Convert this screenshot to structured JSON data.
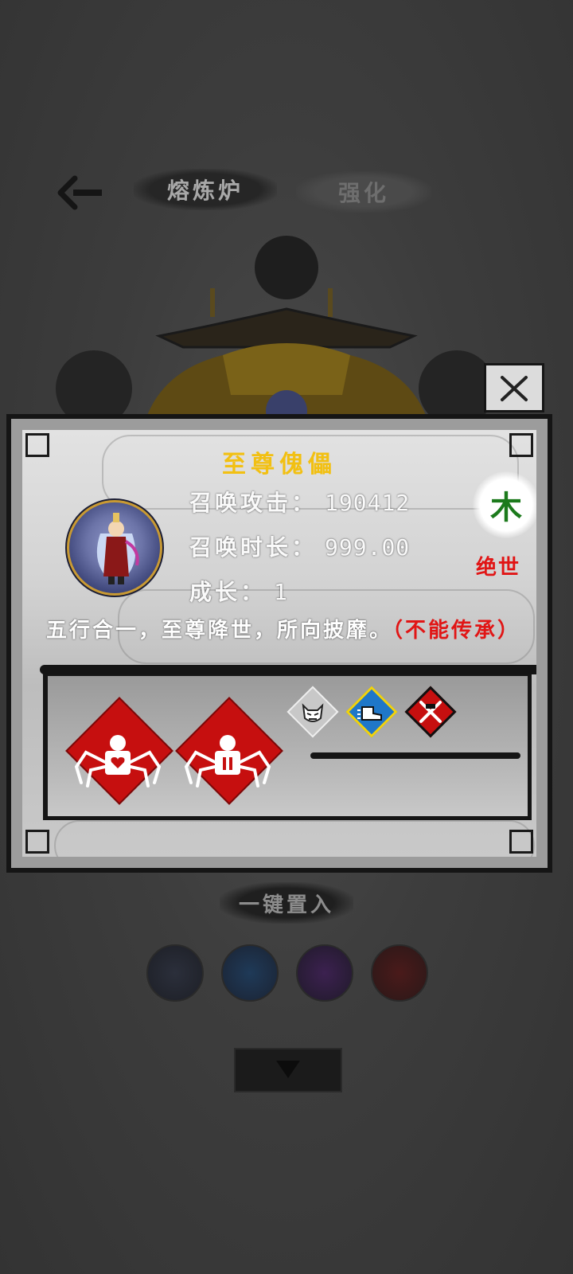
{
  "header": {
    "tabs": [
      {
        "label": "熔炼炉"
      },
      {
        "label": "强化"
      }
    ]
  },
  "furnace": {
    "one_click_label": "一键置入"
  },
  "dialog": {
    "title": "至尊傀儡",
    "stats": [
      {
        "label": "召唤攻击：",
        "value": "190412"
      },
      {
        "label": "召唤时长：",
        "value": "999.00"
      },
      {
        "label": "成长：",
        "value": "1"
      }
    ],
    "element": "木",
    "rank": "绝世",
    "description": "五行合一，至尊降世，所向披靡。",
    "description_note": "（不能传承）"
  },
  "colors": {
    "title": "#f2c012",
    "rank": "#e11515",
    "element": "#1c7a1c",
    "skill_bg": "#c60f0f"
  },
  "icons": {
    "back": "back-arrow-icon",
    "close": "close-icon",
    "skills": [
      "spider-robot-heart-icon",
      "spider-robot-body-icon"
    ],
    "traits": [
      "demon-face-icon",
      "speed-boots-icon",
      "crossed-swords-icon"
    ]
  }
}
